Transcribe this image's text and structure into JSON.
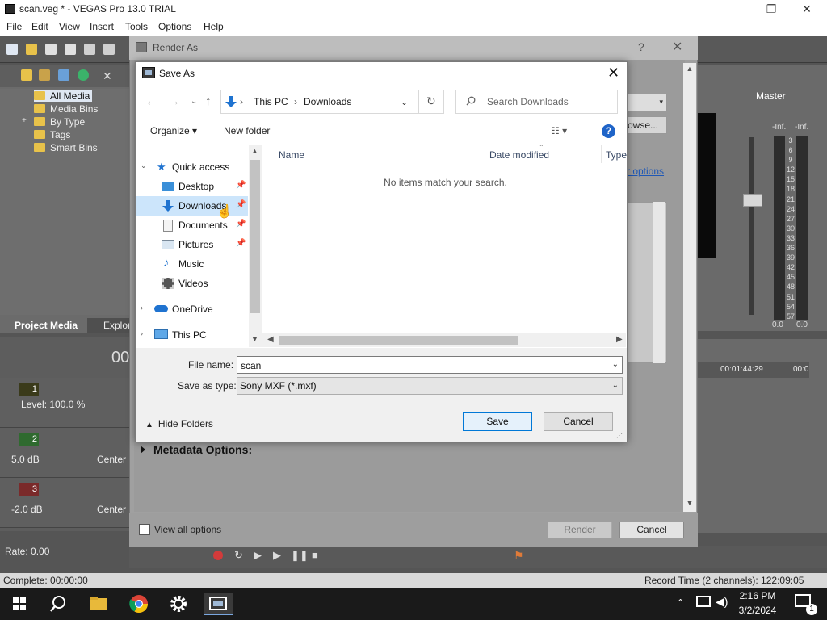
{
  "app": {
    "title": "scan.veg * - VEGAS Pro 13.0 TRIAL",
    "minimize": "—",
    "restore": "❐",
    "close": "✕"
  },
  "menu": [
    "File",
    "Edit",
    "View",
    "Insert",
    "Tools",
    "Options",
    "Help"
  ],
  "media_tree": [
    "All Media",
    "Media Bins",
    "By Type",
    "Tags",
    "Smart Bins"
  ],
  "left_tabs": {
    "project_media": "Project Media",
    "explorer": "Explor"
  },
  "timeline": {
    "timecode": "00",
    "tracks": [
      {
        "num": "1",
        "label": "Level: 100.0 %",
        "center": ""
      },
      {
        "num": "2",
        "label": "5.0 dB",
        "center": "Center"
      },
      {
        "num": "3",
        "label": "-2.0 dB",
        "center": "Center"
      }
    ],
    "ruler": [
      "00:01:44:29",
      "00:0"
    ],
    "rate": "Rate: 0.00"
  },
  "master": {
    "label": "Master",
    "scale": [
      "3",
      "6",
      "9",
      "12",
      "15",
      "18",
      "21",
      "24",
      "27",
      "30",
      "33",
      "36",
      "39",
      "42",
      "45",
      "48",
      "51",
      "54",
      "57"
    ],
    "inf_left": "-Inf.",
    "inf_right": "-Inf.",
    "val_left": "0.0",
    "val_right": "0.0"
  },
  "status": {
    "complete": "Complete: 00:00:00",
    "record_time": "Record Time (2 channels): 122:09:05"
  },
  "render_as": {
    "title": "Render As",
    "help": "?",
    "close": "✕",
    "browse": "owse...",
    "options_link": "r options",
    "metadata": "Metadata Options:",
    "view_all": "View all options",
    "render_btn": "Render",
    "cancel_btn": "Cancel"
  },
  "save_as": {
    "title": "Save As",
    "close": "✕",
    "breadcrumb": [
      "This PC",
      "Downloads"
    ],
    "search_placeholder": "Search Downloads",
    "organize": "Organize ▾",
    "new_folder": "New folder",
    "view_toggle": "☷ ▾",
    "help": "?",
    "nav": {
      "quick_access": "Quick access",
      "desktop": "Desktop",
      "downloads": "Downloads",
      "documents": "Documents",
      "pictures": "Pictures",
      "music": "Music",
      "videos": "Videos",
      "onedrive": "OneDrive",
      "this_pc": "This PC"
    },
    "columns": {
      "name": "Name",
      "date_modified": "Date modified",
      "type": "Type"
    },
    "empty_message": "No items match your search.",
    "file_name_label": "File name:",
    "file_name_value": "scan",
    "save_type_label": "Save as type:",
    "save_type_value": "Sony MXF (*.mxf)",
    "hide_folders": "Hide Folders",
    "save_btn": "Save",
    "cancel_btn": "Cancel"
  },
  "taskbar": {
    "time": "2:16 PM",
    "date": "3/2/2024",
    "notification_count": "1"
  },
  "colors": {
    "accent": "#0078d7",
    "selection": "#cce5fb",
    "help_blue": "#1f64c8",
    "vegas_gray": "#595959"
  }
}
